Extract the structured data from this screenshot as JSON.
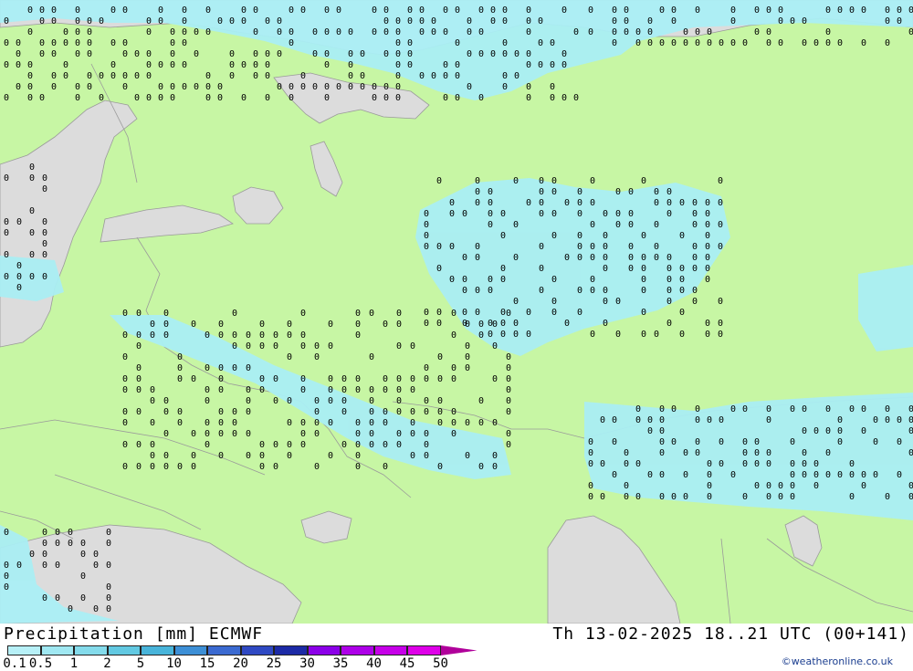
{
  "title": "Precipitation [mm] ECMWF",
  "datetime": "Th 13-02-2025 18..21 UTC (00+141)",
  "credit": "©weatheronline.co.uk",
  "legend": {
    "ticks": [
      "0.1",
      "0.5",
      "1",
      "2",
      "5",
      "10",
      "15",
      "20",
      "25",
      "30",
      "35",
      "40",
      "45",
      "50"
    ],
    "colors": [
      "#b7f0f7",
      "#a0e8f2",
      "#84dbeb",
      "#62c9e2",
      "#48b4da",
      "#3d8fd6",
      "#3b6ad1",
      "#2f49c3",
      "#1c2aa6",
      "#8b00e8",
      "#ad00e8",
      "#c600e8",
      "#de00e8",
      "#b0009a"
    ]
  },
  "map_colors": {
    "land": "#c7f6a4",
    "water": "#dcdcdc",
    "precip": "#aaeef4",
    "border": "#9a9a9a"
  }
}
